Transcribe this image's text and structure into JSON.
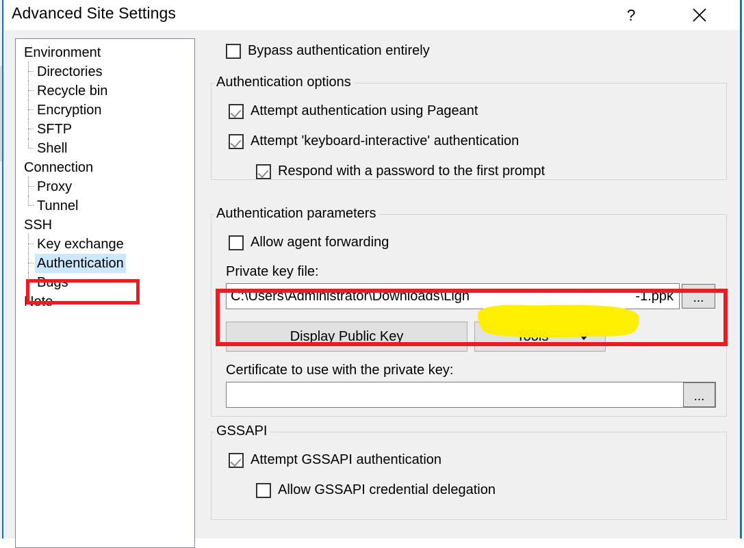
{
  "window": {
    "title": "Advanced Site Settings",
    "help_button": "?",
    "close_button": "close-icon"
  },
  "sidebar": {
    "items": [
      {
        "label": "Environment",
        "level": "root",
        "selected": false
      },
      {
        "label": "Directories",
        "level": "child",
        "selected": false
      },
      {
        "label": "Recycle bin",
        "level": "child",
        "selected": false
      },
      {
        "label": "Encryption",
        "level": "child",
        "selected": false
      },
      {
        "label": "SFTP",
        "level": "child",
        "selected": false
      },
      {
        "label": "Shell",
        "level": "child",
        "selected": false,
        "last": true
      },
      {
        "label": "Connection",
        "level": "root",
        "selected": false
      },
      {
        "label": "Proxy",
        "level": "child",
        "selected": false
      },
      {
        "label": "Tunnel",
        "level": "child",
        "selected": false,
        "last": true
      },
      {
        "label": "SSH",
        "level": "root",
        "selected": false
      },
      {
        "label": "Key exchange",
        "level": "child",
        "selected": false
      },
      {
        "label": "Authentication",
        "level": "child",
        "selected": true
      },
      {
        "label": "Bugs",
        "level": "child",
        "selected": false,
        "last": true
      },
      {
        "label": "Note",
        "level": "root",
        "selected": false
      }
    ]
  },
  "main": {
    "bypass": {
      "label": "Bypass authentication entirely",
      "checked": false
    },
    "auth_options": {
      "legend": "Authentication options",
      "pageant": {
        "label": "Attempt authentication using Pageant",
        "checked": true
      },
      "keyboard_interactive": {
        "label": "Attempt 'keyboard-interactive' authentication",
        "checked": true
      },
      "respond_password": {
        "label": "Respond with a password to the first prompt",
        "checked": true
      }
    },
    "auth_parameters": {
      "legend": "Authentication parameters",
      "agent_forwarding": {
        "label": "Allow agent forwarding",
        "checked": false
      },
      "private_key": {
        "label": "Private key file:",
        "value_visible_prefix": "C:\\Users\\Administrator\\Downloads\\Ligh",
        "value_visible_suffix": "-1.ppk",
        "redacted": true,
        "browse_label": "..."
      },
      "display_public_key_button": "Display Public Key",
      "tools_button": "Tools",
      "certificate": {
        "label": "Certificate to use with the private key:",
        "value": "",
        "browse_label": "..."
      }
    },
    "gssapi": {
      "legend": "GSSAPI",
      "attempt": {
        "label": "Attempt GSSAPI authentication",
        "checked": true
      },
      "delegation": {
        "label": "Allow GSSAPI credential delegation",
        "checked": false
      }
    }
  },
  "annotations": {
    "tree_highlight_color": "#ec1c24",
    "key_field_highlight_color": "#ec1c24",
    "redaction_color": "#ffed00"
  }
}
